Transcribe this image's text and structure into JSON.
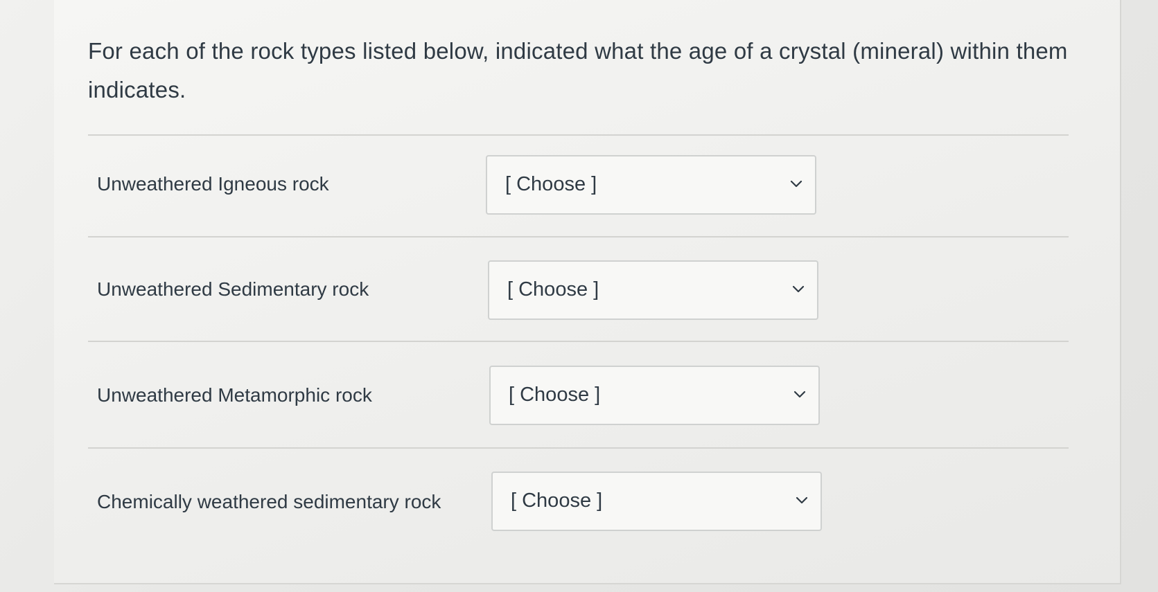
{
  "question": {
    "prompt": "For each of the rock types listed below, indicated what the age of a crystal (mineral) within them indicates."
  },
  "rows": [
    {
      "label": "Unweathered Igneous rock",
      "select_value": "[ Choose ]"
    },
    {
      "label": "Unweathered Sedimentary rock",
      "select_value": "[ Choose ]"
    },
    {
      "label": "Unweathered Metamorphic rock",
      "select_value": "[ Choose ]"
    },
    {
      "label": "Chemically weathered sedimentary rock",
      "select_value": "[ Choose ]"
    }
  ],
  "icons": {
    "dropdown": "chevron-down-icon"
  }
}
